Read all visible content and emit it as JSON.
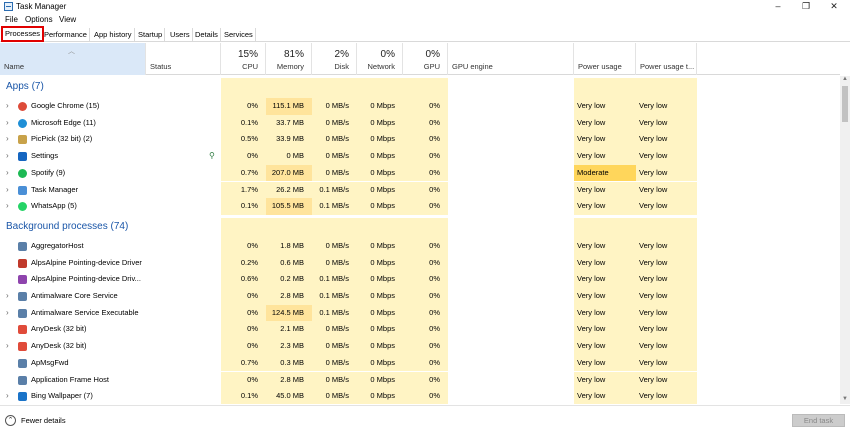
{
  "window": {
    "title": "Task Manager",
    "minimize_glyph": "–",
    "maximize_glyph": "❐",
    "close_glyph": "✕"
  },
  "menu": [
    "File",
    "Options",
    "View"
  ],
  "tabs": [
    "Processes",
    "Performance",
    "App history",
    "Startup",
    "Users",
    "Details",
    "Services"
  ],
  "header": {
    "name": "Name",
    "status": "Status",
    "cpu": {
      "pct": "15%",
      "label": "CPU"
    },
    "memory": {
      "pct": "81%",
      "label": "Memory"
    },
    "disk": {
      "pct": "2%",
      "label": "Disk"
    },
    "network": {
      "pct": "0%",
      "label": "Network"
    },
    "gpu": {
      "pct": "0%",
      "label": "GPU"
    },
    "gpu_engine": "GPU engine",
    "power": "Power usage",
    "power_trend": "Power usage t..."
  },
  "apps_group": "Apps (7)",
  "bg_group": "Background processes (74)",
  "apps": [
    {
      "name": "Google Chrome (15)",
      "cpu": "0%",
      "mem": "115.1 MB",
      "disk": "0 MB/s",
      "net": "0 Mbps",
      "gpu": "0%",
      "power": "Very low",
      "trend": "Very low",
      "icon": "chrome-icon",
      "color": "#dd4b39",
      "expand": true
    },
    {
      "name": "Microsoft Edge (11)",
      "cpu": "0.1%",
      "mem": "33.7 MB",
      "disk": "0 MB/s",
      "net": "0 Mbps",
      "gpu": "0%",
      "power": "Very low",
      "trend": "Very low",
      "icon": "edge-icon",
      "color": "#1f8fd6",
      "expand": true
    },
    {
      "name": "PicPick (32 bit) (2)",
      "cpu": "0.5%",
      "mem": "33.9 MB",
      "disk": "0 MB/s",
      "net": "0 Mbps",
      "gpu": "0%",
      "power": "Very low",
      "trend": "Very low",
      "icon": "picpick-icon",
      "color": "#c8a24a",
      "expand": true
    },
    {
      "name": "Settings",
      "cpu": "0%",
      "mem": "0 MB",
      "disk": "0 MB/s",
      "net": "0 Mbps",
      "gpu": "0%",
      "power": "Very low",
      "trend": "Very low",
      "icon": "settings-icon",
      "color": "#1565c0",
      "expand": true,
      "status_icon": true
    },
    {
      "name": "Spotify (9)",
      "cpu": "0.7%",
      "mem": "207.0 MB",
      "disk": "0 MB/s",
      "net": "0 Mbps",
      "gpu": "0%",
      "power": "Moderate",
      "trend": "Very low",
      "icon": "spotify-icon",
      "color": "#1db954",
      "expand": true,
      "moderate": true
    },
    {
      "name": "Task Manager",
      "cpu": "1.7%",
      "mem": "26.2 MB",
      "disk": "0.1 MB/s",
      "net": "0 Mbps",
      "gpu": "0%",
      "power": "Very low",
      "trend": "Very low",
      "icon": "task-manager-icon",
      "color": "#4a8fd6",
      "expand": true
    },
    {
      "name": "WhatsApp (5)",
      "cpu": "0.1%",
      "mem": "105.5 MB",
      "disk": "0.1 MB/s",
      "net": "0 Mbps",
      "gpu": "0%",
      "power": "Very low",
      "trend": "Very low",
      "icon": "whatsapp-icon",
      "color": "#25d366",
      "expand": true
    }
  ],
  "bg": [
    {
      "name": "AggregatorHost",
      "cpu": "0%",
      "mem": "1.8 MB",
      "disk": "0 MB/s",
      "net": "0 Mbps",
      "gpu": "0%",
      "power": "Very low",
      "trend": "Very low",
      "icon": "generic-process-icon",
      "color": "#5a7fa8",
      "expand": false
    },
    {
      "name": "AlpsAlpine Pointing-device Driver",
      "cpu": "0.2%",
      "mem": "0.6 MB",
      "disk": "0 MB/s",
      "net": "0 Mbps",
      "gpu": "0%",
      "power": "Very low",
      "trend": "Very low",
      "icon": "alps-icon",
      "color": "#c0392b",
      "expand": false
    },
    {
      "name": "AlpsAlpine Pointing-device Driv...",
      "cpu": "0.6%",
      "mem": "0.2 MB",
      "disk": "0.1 MB/s",
      "net": "0 Mbps",
      "gpu": "0%",
      "power": "Very low",
      "trend": "Very low",
      "icon": "alps-icon",
      "color": "#8e44ad",
      "expand": false
    },
    {
      "name": "Antimalware Core Service",
      "cpu": "0%",
      "mem": "2.8 MB",
      "disk": "0.1 MB/s",
      "net": "0 Mbps",
      "gpu": "0%",
      "power": "Very low",
      "trend": "Very low",
      "icon": "generic-process-icon",
      "color": "#5a7fa8",
      "expand": true
    },
    {
      "name": "Antimalware Service Executable",
      "cpu": "0%",
      "mem": "124.5 MB",
      "disk": "0.1 MB/s",
      "net": "0 Mbps",
      "gpu": "0%",
      "power": "Very low",
      "trend": "Very low",
      "icon": "generic-process-icon",
      "color": "#5a7fa8",
      "expand": true
    },
    {
      "name": "AnyDesk (32 bit)",
      "cpu": "0%",
      "mem": "2.1 MB",
      "disk": "0 MB/s",
      "net": "0 Mbps",
      "gpu": "0%",
      "power": "Very low",
      "trend": "Very low",
      "icon": "anydesk-icon",
      "color": "#e04b3a",
      "expand": false
    },
    {
      "name": "AnyDesk (32 bit)",
      "cpu": "0%",
      "mem": "2.3 MB",
      "disk": "0 MB/s",
      "net": "0 Mbps",
      "gpu": "0%",
      "power": "Very low",
      "trend": "Very low",
      "icon": "anydesk-icon",
      "color": "#e04b3a",
      "expand": true
    },
    {
      "name": "ApMsgFwd",
      "cpu": "0.7%",
      "mem": "0.3 MB",
      "disk": "0 MB/s",
      "net": "0 Mbps",
      "gpu": "0%",
      "power": "Very low",
      "trend": "Very low",
      "icon": "generic-process-icon",
      "color": "#5a7fa8",
      "expand": false
    },
    {
      "name": "Application Frame Host",
      "cpu": "0%",
      "mem": "2.8 MB",
      "disk": "0 MB/s",
      "net": "0 Mbps",
      "gpu": "0%",
      "power": "Very low",
      "trend": "Very low",
      "icon": "generic-process-icon",
      "color": "#5a7fa8",
      "expand": false
    },
    {
      "name": "Bing Wallpaper (7)",
      "cpu": "0.1%",
      "mem": "45.0 MB",
      "disk": "0 MB/s",
      "net": "0 Mbps",
      "gpu": "0%",
      "power": "Very low",
      "trend": "Very low",
      "icon": "bing-icon",
      "color": "#1a73c8",
      "expand": true
    }
  ],
  "footer": {
    "fewer_details": "Fewer details",
    "end_task": "End task",
    "fewer_glyph": "⌃"
  },
  "colors": {
    "accent_red": "#e00000",
    "heat_light": "#fff4c4",
    "heat_moderate": "#ffd65b",
    "group_blue": "#1a56a8"
  }
}
